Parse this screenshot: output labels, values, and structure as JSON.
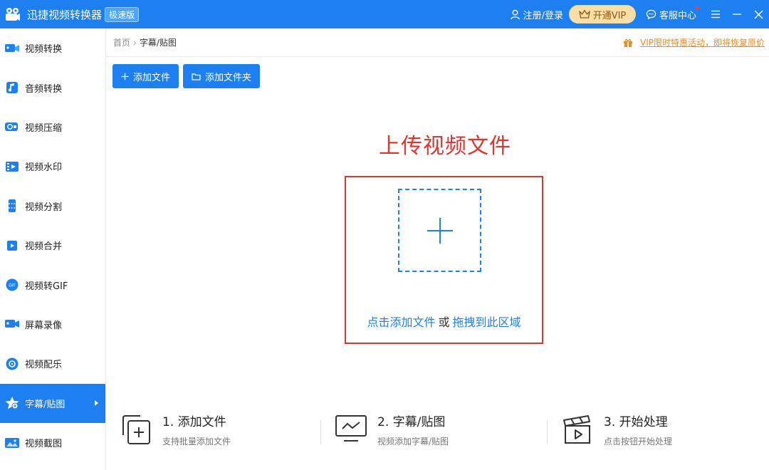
{
  "app": {
    "title": "迅捷视频转换器",
    "badge": "极速版",
    "login_label": "注册/登录",
    "vip_label": "开通VIP",
    "service_label": "客服中心"
  },
  "sidebar": {
    "items": [
      {
        "label": "视频转换",
        "icon": "video-convert-icon"
      },
      {
        "label": "音频转换",
        "icon": "audio-convert-icon"
      },
      {
        "label": "视频压缩",
        "icon": "video-compress-icon"
      },
      {
        "label": "视频水印",
        "icon": "video-watermark-icon"
      },
      {
        "label": "视频分割",
        "icon": "video-split-icon"
      },
      {
        "label": "视频合并",
        "icon": "video-merge-icon"
      },
      {
        "label": "视频转GIF",
        "icon": "video-to-gif-icon"
      },
      {
        "label": "屏幕录像",
        "icon": "screen-record-icon"
      },
      {
        "label": "视频配乐",
        "icon": "video-music-icon"
      },
      {
        "label": "字幕/贴图",
        "icon": "subtitle-sticker-icon",
        "active": true
      },
      {
        "label": "视频截图",
        "icon": "video-screenshot-icon"
      }
    ]
  },
  "breadcrumb": {
    "home": "首页",
    "separator": "›",
    "current": "字幕/贴图"
  },
  "promo": {
    "text": "VIP限时特惠活动，即将恢复原价"
  },
  "toolbar": {
    "add_file": "添加文件",
    "add_folder": "添加文件夹"
  },
  "upload": {
    "title": "上传视频文件",
    "click_add": "点击添加文件",
    "or": "或",
    "drag_here": "拖拽到此区域"
  },
  "steps": [
    {
      "title": "1. 添加文件",
      "desc": "支持批量添加文件"
    },
    {
      "title": "2. 字幕/贴图",
      "desc": "视频添加字幕/贴图"
    },
    {
      "title": "3. 开始处理",
      "desc": "点击按钮开始处理"
    }
  ],
  "colors": {
    "brand": "#1e7ff0",
    "highlight_red": "#e8322c",
    "vip_gold": "#f9dfa5",
    "promo_orange": "#f08a24"
  }
}
